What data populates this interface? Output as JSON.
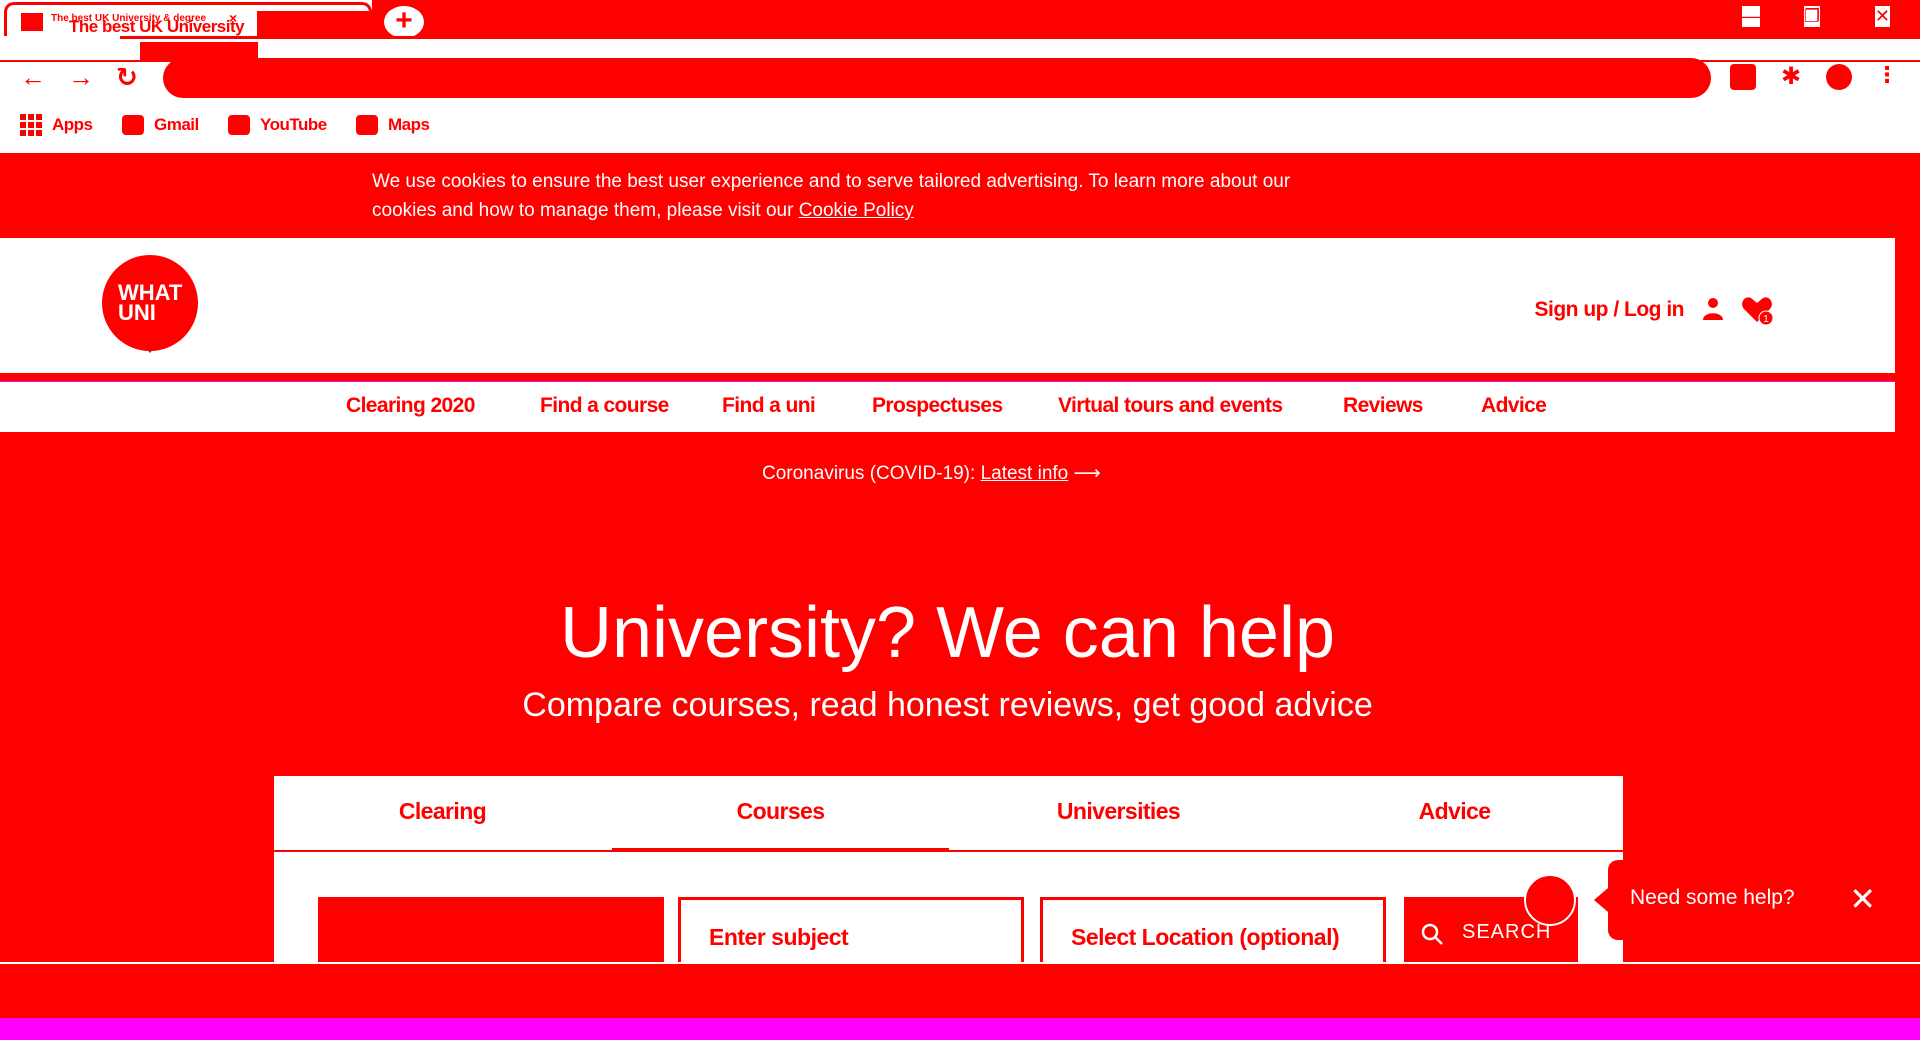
{
  "browser": {
    "tab_title": "The best UK University",
    "tab_title_small": "The best UK University & degree",
    "tab_close": "×",
    "new_tab": "+",
    "window_minimize": "—",
    "window_restore": "❐",
    "window_close": "✕",
    "bookmarks": [
      {
        "label": "Apps",
        "icon": "apps-grid-icon"
      },
      {
        "label": "Gmail",
        "icon": "gmail-icon"
      },
      {
        "label": "YouTube",
        "icon": "youtube-icon"
      },
      {
        "label": "Maps",
        "icon": "maps-icon"
      }
    ]
  },
  "cookie_banner": {
    "text": "We use cookies to ensure the best user experience and to serve tailored advertising. To learn more about our cookies and how to manage them, please visit our",
    "link": "Cookie Policy"
  },
  "header": {
    "logo_line1": "WHAT",
    "logo_line2": "UNI",
    "signin": "Sign up / Log in",
    "favourites_count": "1"
  },
  "nav": {
    "items": [
      "Clearing 2020",
      "Find a course",
      "Find a uni",
      "Prospectuses",
      "Virtual tours and events",
      "Reviews",
      "Advice"
    ]
  },
  "hero": {
    "covid_text": "Coronavirus (COVID-19):",
    "covid_link": "Latest info",
    "title": "University? We can help",
    "subtitle": "Compare courses, read honest reviews, get good advice"
  },
  "search": {
    "tabs": [
      "Clearing",
      "Courses",
      "Universities",
      "Advice"
    ],
    "active_tab": "Courses",
    "subject_placeholder": "Enter subject",
    "location_placeholder": "Select Location (optional)",
    "button": "SEARCH"
  },
  "chat": {
    "text": "Need some help?",
    "close": "✕"
  },
  "colors": {
    "accent": "#ff0000",
    "background": "#ffffff",
    "frame": "#ff00ff"
  }
}
